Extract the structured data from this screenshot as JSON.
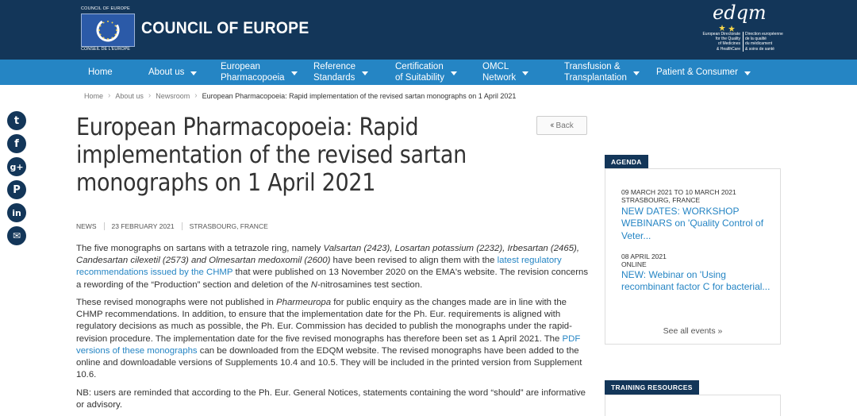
{
  "header": {
    "coe_small_top": "COUNCIL OF EUROPE",
    "coe_small_bottom": "CONSEIL DE L'EUROPE",
    "coe_title": "COUNCIL OF EUROPE",
    "edqm_word": "edqm",
    "edqm_en": [
      "European Directorate",
      "for the Quality",
      "of Medicines",
      "& HealthCare"
    ],
    "edqm_fr": [
      "Direction européenne",
      "de la qualité",
      "du médicament",
      "& soins de santé"
    ],
    "colors": {
      "topbar": "#133659",
      "nav": "#2585c4",
      "link": "#2585c4"
    }
  },
  "nav": {
    "items": [
      {
        "label": "Home",
        "dropdown": false
      },
      {
        "label": "About us",
        "dropdown": true
      },
      {
        "label": "European\nPharmacopoeia",
        "dropdown": true
      },
      {
        "label": "Reference\nStandards",
        "dropdown": true
      },
      {
        "label": "Certification\nof Suitability",
        "dropdown": true
      },
      {
        "label": "OMCL\nNetwork",
        "dropdown": true
      },
      {
        "label": "Transfusion &\nTransplantation",
        "dropdown": true
      },
      {
        "label": "Patient & Consumer",
        "dropdown": true
      }
    ]
  },
  "breadcrumb": {
    "items": [
      "Home",
      "About us",
      "Newsroom"
    ],
    "current": "European Pharmacopoeia: Rapid implementation of the revised sartan monographs on 1 April 2021"
  },
  "social": {
    "icons": [
      {
        "name": "twitter-icon",
        "glyph": "t"
      },
      {
        "name": "facebook-icon",
        "glyph": "f"
      },
      {
        "name": "google-plus-icon",
        "glyph": "g+"
      },
      {
        "name": "pinterest-icon",
        "glyph": "P"
      },
      {
        "name": "linkedin-icon",
        "glyph": "in"
      },
      {
        "name": "email-icon",
        "glyph": "✉"
      }
    ]
  },
  "article": {
    "title": "European Pharmacopoeia: Rapid implementation of the revised sartan monographs on 1 April 2021",
    "back_label": "Back",
    "category": "NEWS",
    "date": "23 FEBRUARY 2021",
    "location": "STRASBOURG, FRANCE",
    "p1": {
      "t1": "The five monographs on sartans with a tetrazole ring, namely ",
      "i1": "Valsartan (2423), Losartan potassium (2232), Irbesartan (2465), Candesartan cilexetil (2573) and Olmesartan medoxomil (2600)",
      "t2": " have been revised to align them with the ",
      "link": "latest regulatory recommendations issued by the CHMP",
      "t3": " that were published on 13 November 2020 on the EMA's website. The revision concerns a rewording of the “Production” section and deletion of the ",
      "i2": "N",
      "t4": "-nitrosamines test section."
    },
    "p2": {
      "t1": "These revised monographs were not published in ",
      "i1": "Pharmeuropa",
      "t2": " for public enquiry as the changes made are in line with the CHMP recommendations. In addition, to ensure that the implementation date for the Ph. Eur. requirements is aligned with regulatory decisions as much as possible, the Ph. Eur. Commission has decided to publish the monographs under the rapid-revision procedure. The implementation date for the five revised monographs has therefore been set as 1 April 2021. The ",
      "link": "PDF versions of these monographs",
      "t3": " can be downloaded from the EDQM website. The revised monographs have been added to the online and downloadable versions of Supplements 10.4 and 10.5. They will be included in the printed version from Supplement 10.6."
    },
    "p3": "NB: users are reminded that according to the Ph. Eur. General Notices, statements containing the word “should” are informative or advisory."
  },
  "sidebar": {
    "agenda_label": "AGENDA",
    "events": [
      {
        "date": "09 MARCH 2021 TO 10 MARCH 2021",
        "place": "STRASBOURG, FRANCE",
        "title": "NEW DATES: WORKSHOP WEBINARS on 'Quality Control of Veter..."
      },
      {
        "date": "08 APRIL 2021",
        "place": "ONLINE",
        "title": "NEW: Webinar on 'Using recombinant factor C for bacterial..."
      }
    ],
    "see_all": "See all events »",
    "training_label": "TRAINING RESOURCES"
  }
}
